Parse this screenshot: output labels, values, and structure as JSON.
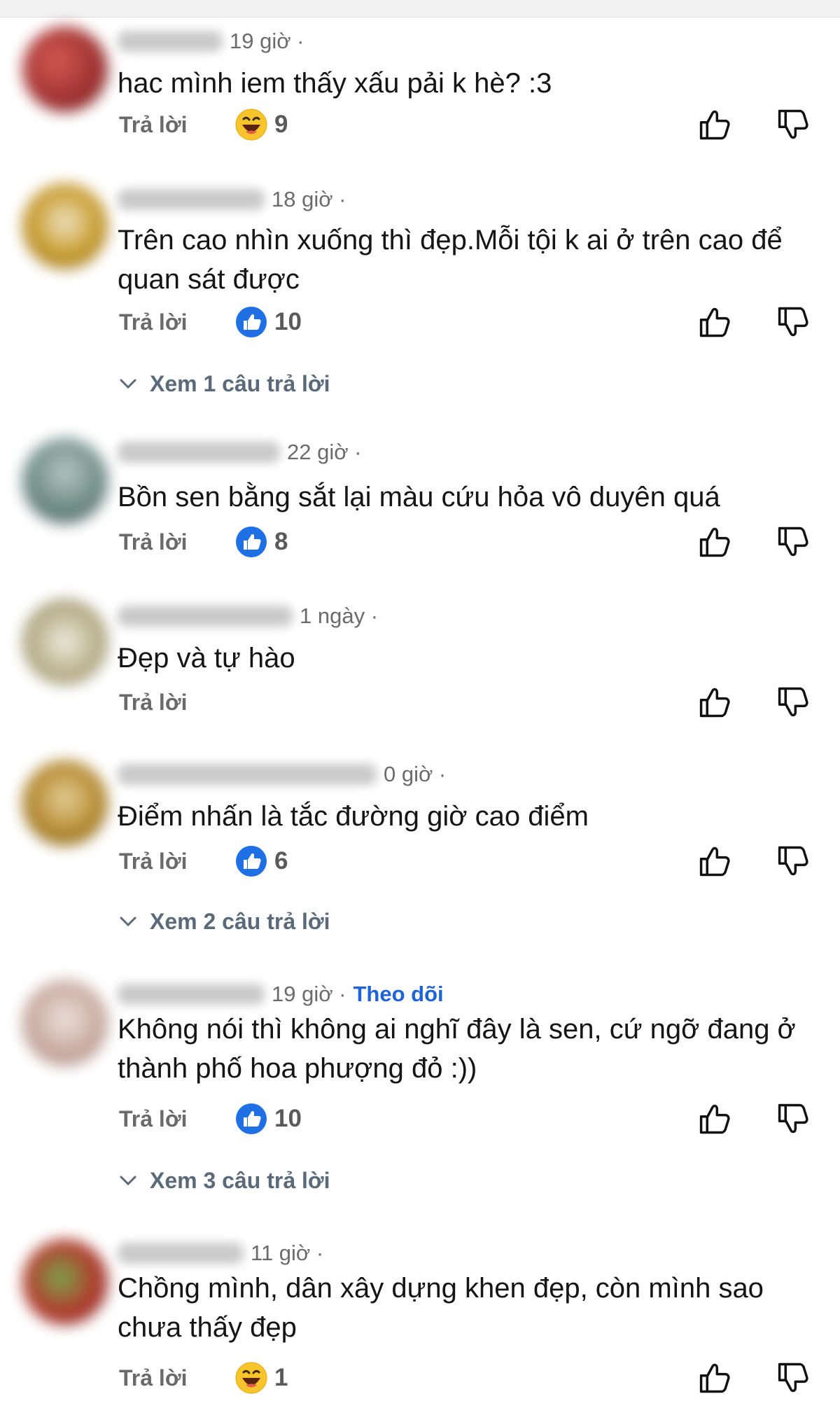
{
  "colors": {
    "like_blue": "#1f6fe5",
    "haha_yellow": "#f7c52b",
    "follow_blue": "#1f63d8",
    "meta_gray": "#6b6b6b"
  },
  "reply_label": "Trả lời",
  "comments": [
    {
      "time": "19 giờ ·",
      "text": "hac mình iem thấy xấu pải k hè? :3",
      "reaction_icon": "haha-emoji-icon",
      "reaction_count": "9"
    },
    {
      "time": "18 giờ ·",
      "text": "Trên cao nhìn xuống thì đẹp.Mỗi tội k ai ở trên cao để quan sát được",
      "reaction_icon": "like-reaction-icon",
      "reaction_count": "10",
      "thread": "Xem 1 câu trả lời"
    },
    {
      "time": "22 giờ ·",
      "text": "Bồn sen bằng sắt lại màu cứu hỏa vô duyên quá",
      "reaction_icon": "like-reaction-icon",
      "reaction_count": "8"
    },
    {
      "time": "1 ngày ·",
      "text": "Đẹp và tự hào"
    },
    {
      "time": "0 giờ ·",
      "text": "Điểm nhấn là tắc đường giờ cao điểm",
      "reaction_icon": "like-reaction-icon",
      "reaction_count": "6",
      "thread": "Xem 2 câu trả lời"
    },
    {
      "time": "19 giờ ·",
      "follow": "Theo dõi",
      "text": "Không nói thì không ai nghĩ đây là sen, cứ ngỡ đang ở thành phố hoa phượng đỏ :))",
      "reaction_icon": "like-reaction-icon",
      "reaction_count": "10",
      "thread": "Xem 3 câu trả lời"
    },
    {
      "time": "11 giờ ·",
      "text": "Chồng mình, dân xây dựng khen đẹp, còn mình sao chưa thấy đẹp",
      "reaction_icon": "haha-emoji-icon",
      "reaction_count": "1"
    }
  ]
}
